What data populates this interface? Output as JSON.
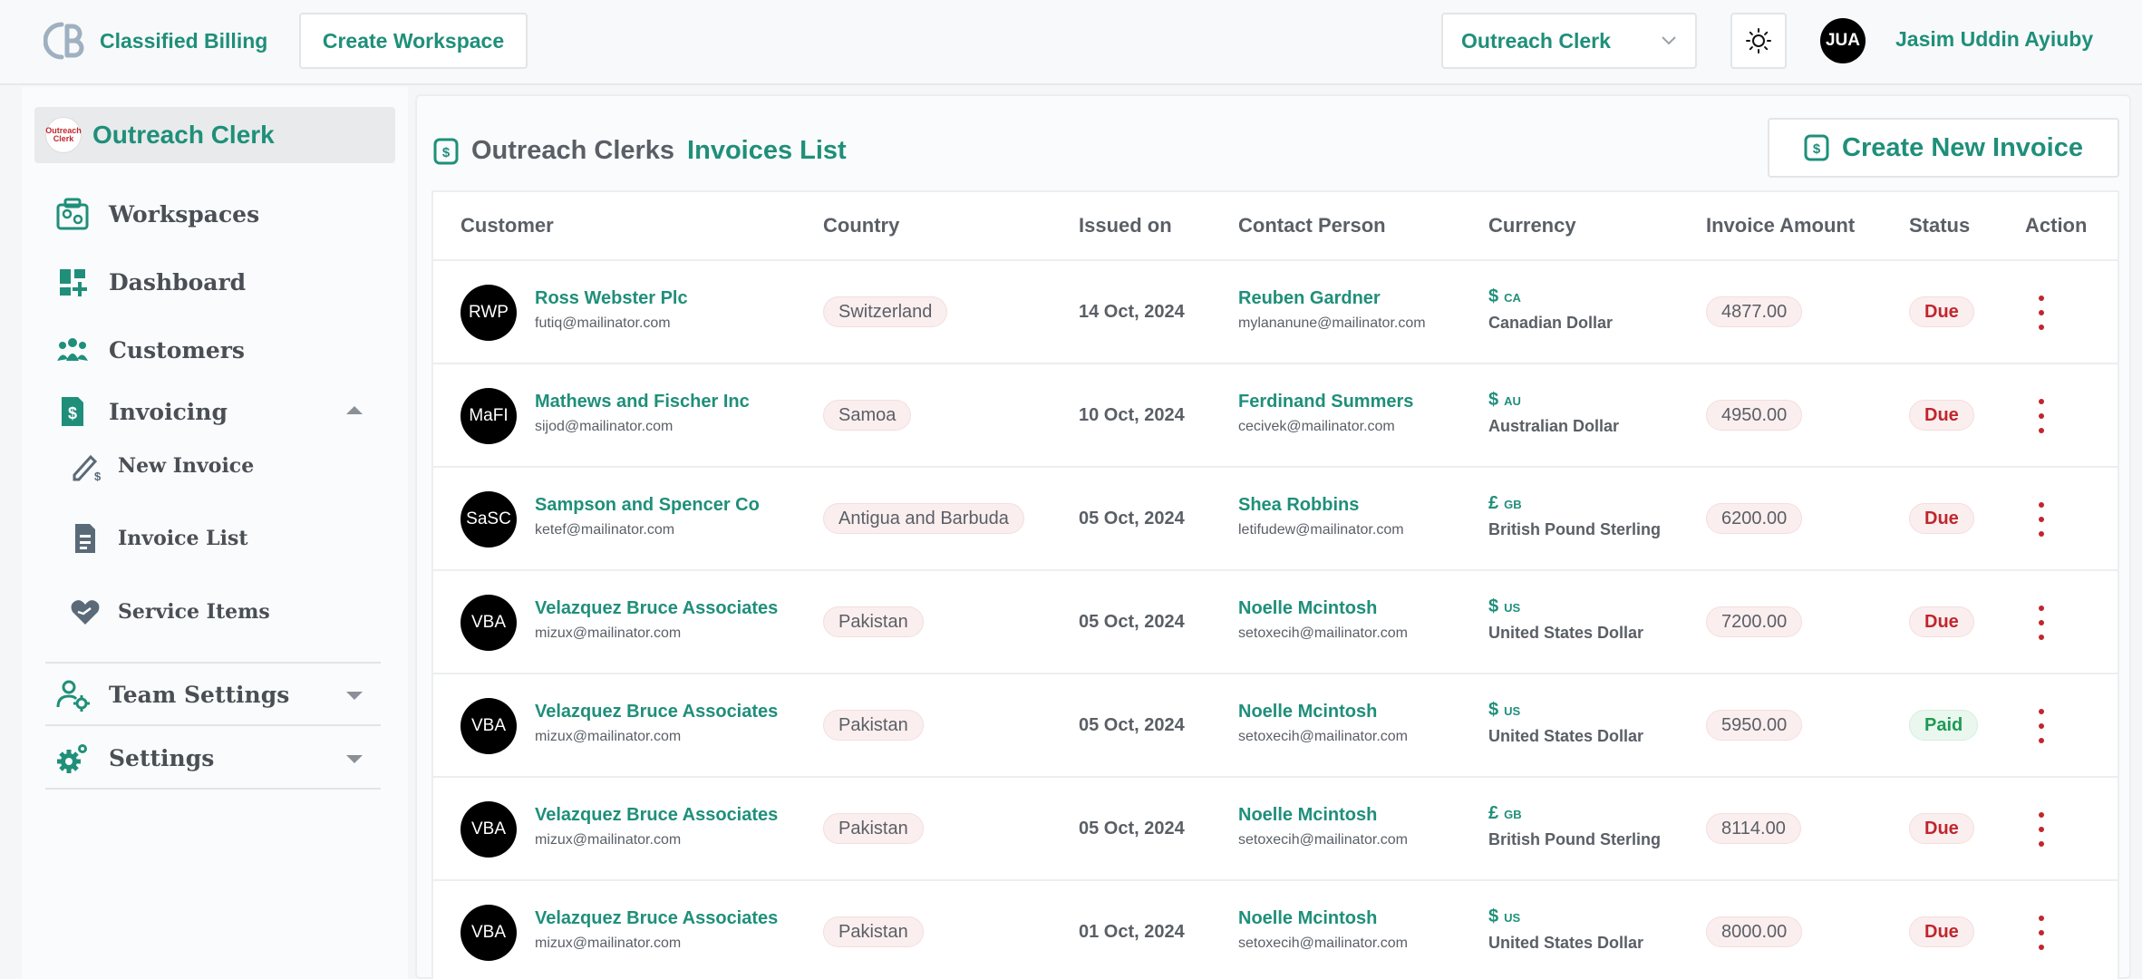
{
  "header": {
    "brand": "Classified Billing",
    "create_workspace": "Create Workspace",
    "workspace_select": "Outreach Clerk",
    "user_initials": "JUA",
    "user_name": "Jasim Uddin Ayiuby"
  },
  "sidebar": {
    "workspace_name": "Outreach Clerk",
    "workspace_logo_text": [
      "Outreach",
      "Clerk"
    ],
    "workspaces": "Workspaces",
    "dashboard": "Dashboard",
    "customers": "Customers",
    "invoicing": "Invoicing",
    "new_invoice": "New Invoice",
    "invoice_list": "Invoice List",
    "service_items": "Service Items",
    "team_settings": "Team Settings",
    "settings": "Settings"
  },
  "main": {
    "title_prefix": "Outreach Clerks",
    "title": "Invoices List",
    "create_button": "Create New Invoice",
    "columns": [
      "Customer",
      "Country",
      "Issued on",
      "Contact Person",
      "Currency",
      "Invoice Amount",
      "Status",
      "Action"
    ],
    "rows": [
      {
        "initials": "RWP",
        "name": "Ross Webster Plc",
        "email": "futiq@mailinator.com",
        "country": "Switzerland",
        "issued": "14 Oct, 2024",
        "contact": "Reuben Gardner",
        "contact_email": "mylananune@mailinator.com",
        "symbol": "$",
        "code": "CA",
        "currency": "Canadian Dollar",
        "amount": "4877.00",
        "status": "Due"
      },
      {
        "initials": "MaFI",
        "name": "Mathews and Fischer Inc",
        "email": "sijod@mailinator.com",
        "country": "Samoa",
        "issued": "10 Oct, 2024",
        "contact": "Ferdinand Summers",
        "contact_email": "cecivek@mailinator.com",
        "symbol": "$",
        "code": "AU",
        "currency": "Australian Dollar",
        "amount": "4950.00",
        "status": "Due"
      },
      {
        "initials": "SaSC",
        "name": "Sampson and Spencer Co",
        "email": "ketef@mailinator.com",
        "country": "Antigua and Barbuda",
        "issued": "05 Oct, 2024",
        "contact": "Shea Robbins",
        "contact_email": "letifudew@mailinator.com",
        "symbol": "£",
        "code": "GB",
        "currency": "British Pound Sterling",
        "amount": "6200.00",
        "status": "Due"
      },
      {
        "initials": "VBA",
        "name": "Velazquez Bruce Associates",
        "email": "mizux@mailinator.com",
        "country": "Pakistan",
        "issued": "05 Oct, 2024",
        "contact": "Noelle Mcintosh",
        "contact_email": "setoxecih@mailinator.com",
        "symbol": "$",
        "code": "US",
        "currency": "United States Dollar",
        "amount": "7200.00",
        "status": "Due"
      },
      {
        "initials": "VBA",
        "name": "Velazquez Bruce Associates",
        "email": "mizux@mailinator.com",
        "country": "Pakistan",
        "issued": "05 Oct, 2024",
        "contact": "Noelle Mcintosh",
        "contact_email": "setoxecih@mailinator.com",
        "symbol": "$",
        "code": "US",
        "currency": "United States Dollar",
        "amount": "5950.00",
        "status": "Paid"
      },
      {
        "initials": "VBA",
        "name": "Velazquez Bruce Associates",
        "email": "mizux@mailinator.com",
        "country": "Pakistan",
        "issued": "05 Oct, 2024",
        "contact": "Noelle Mcintosh",
        "contact_email": "setoxecih@mailinator.com",
        "symbol": "£",
        "code": "GB",
        "currency": "British Pound Sterling",
        "amount": "8114.00",
        "status": "Due"
      },
      {
        "initials": "VBA",
        "name": "Velazquez Bruce Associates",
        "email": "mizux@mailinator.com",
        "country": "Pakistan",
        "issued": "01 Oct, 2024",
        "contact": "Noelle Mcintosh",
        "contact_email": "setoxecih@mailinator.com",
        "symbol": "$",
        "code": "US",
        "currency": "United States Dollar",
        "amount": "8000.00",
        "status": "Due"
      }
    ]
  },
  "colors": {
    "accent": "#1f8f7a",
    "danger": "#c0262d",
    "success": "#1f9a55"
  },
  "icons": [
    "brand-logo-icon",
    "chevron-down-icon",
    "sun-icon",
    "workspaces-icon",
    "dashboard-icon",
    "customers-icon",
    "invoicing-icon",
    "new-invoice-icon",
    "invoice-list-icon",
    "service-items-icon",
    "team-settings-icon",
    "settings-icon",
    "invoice-dollar-icon",
    "kebab-menu-icon"
  ]
}
